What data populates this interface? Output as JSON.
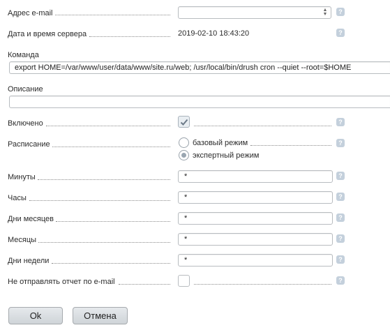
{
  "fields": {
    "email": {
      "label": "Адрес e-mail",
      "value": ""
    },
    "server_time": {
      "label": "Дата и время сервера",
      "value": "2019-02-10 18:43:20"
    },
    "command": {
      "label": "Команда",
      "value": "export HOME=/var/www/user/data/www/site.ru/web; /usr/local/bin/drush cron --quiet --root=$HOME"
    },
    "description": {
      "label": "Описание",
      "value": ""
    },
    "enabled": {
      "label": "Включено",
      "checked": true
    },
    "schedule": {
      "label": "Расписание",
      "options": [
        "базовый режим",
        "экспертный режим"
      ],
      "selected": "экспертный режим"
    },
    "minutes": {
      "label": "Минуты",
      "value": "*"
    },
    "hours": {
      "label": "Часы",
      "value": "*"
    },
    "days_of_month": {
      "label": "Дни месяцев",
      "value": "*"
    },
    "months": {
      "label": "Месяцы",
      "value": "*"
    },
    "days_of_week": {
      "label": "Дни недели",
      "value": "*"
    },
    "no_email_report": {
      "label": "Не отправлять отчет по e-mail",
      "checked": false
    }
  },
  "help_glyph": "?",
  "buttons": {
    "ok": "Ok",
    "cancel": "Отмена"
  },
  "colors": {
    "help_badge": "#c4d0dc",
    "button_bg": "#d9dde1",
    "input_border": "#b8bcc0"
  }
}
